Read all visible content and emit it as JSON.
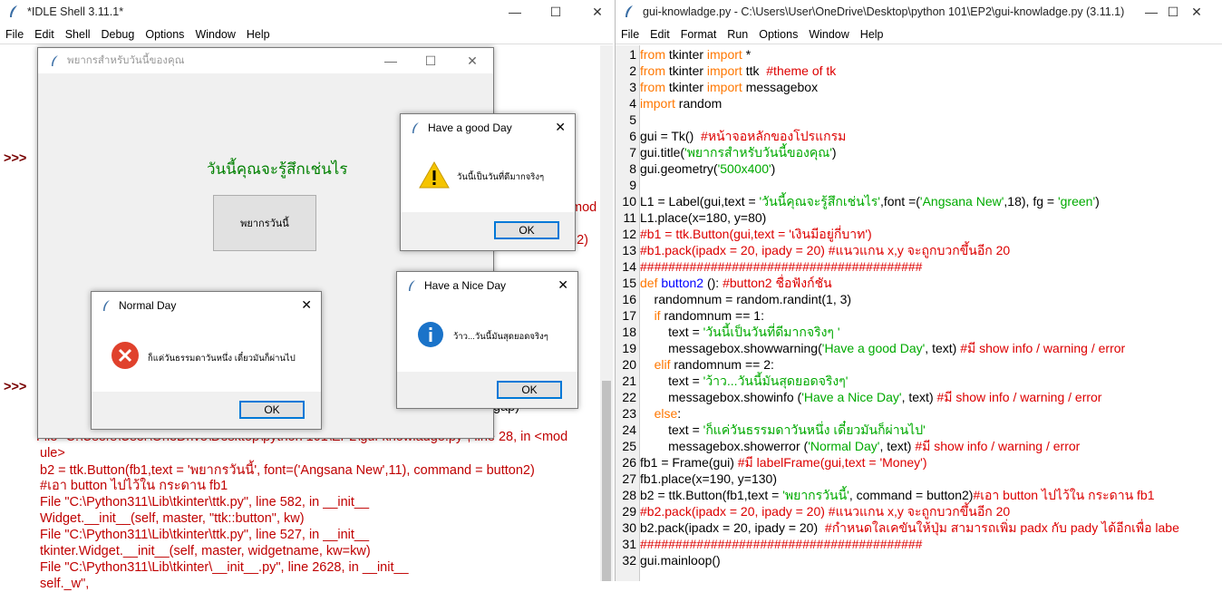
{
  "shell": {
    "title": "*IDLE Shell 3.11.1*",
    "menu": [
      "File",
      "Edit",
      "Shell",
      "Debug",
      "Options",
      "Window",
      "Help"
    ],
    "prompt": ">>>",
    "partial_right_1": "mod",
    "partial_right_2": "n2)",
    "partial_right_3": "gap)",
    "traceback": [
      {
        "text": "  File \"C:\\Users\\User\\OneDrive\\Desktop\\python 101\\EP2\\gui-knowladge.py\", line 28, in <mod"
      },
      {
        "text": "ule>"
      },
      {
        "text": "    b2 = ttk.Button(fb1,text = 'พยากรวันนี้', font=('Angsana New',11), command = button2)"
      },
      {
        "text": "#เอา button ไปไว้ใน กระดาน fb1"
      },
      {
        "text": "  File \"C:\\Python311\\Lib\\tkinter\\ttk.py\", line 582, in __init__"
      },
      {
        "text": "    Widget.__init__(self, master, \"ttk::button\", kw)"
      },
      {
        "text": "  File \"C:\\Python311\\Lib\\tkinter\\ttk.py\", line 527, in __init__"
      },
      {
        "text": "    tkinter.Widget.__init__(self, master, widgetname, kw=kw)"
      },
      {
        "text": "  File \"C:\\Python311\\Lib\\tkinter\\__init__.py\", line 2628, in __init__"
      },
      {
        "text": "    self._w\", "
      }
    ]
  },
  "app": {
    "title": "พยากรสำหรับวันนี้ของคุณ",
    "label": "วันนี้คุณจะรู้สึกเช่นไร",
    "label_color": "#008000",
    "button": "พยากรวันนี้"
  },
  "dialogs": {
    "good": {
      "title": "Have a good Day",
      "message": "วันนี้เป็นวันที่ดีมากจริงๆ",
      "ok": "OK",
      "icon": "warning-icon"
    },
    "nice": {
      "title": "Have a Nice Day",
      "message": "ว้าว...วันนี้มันสุดยอดจริงๆ",
      "ok": "OK",
      "icon": "info-icon"
    },
    "normal": {
      "title": "Normal Day",
      "message": "ก็แค่วันธรรมดาวันหนึ่ง เดี๋ยวมันก็ผ่านไป",
      "ok": "OK",
      "icon": "error-icon"
    }
  },
  "editor": {
    "title": "gui-knowladge.py - C:\\Users\\User\\OneDrive\\Desktop\\python 101\\EP2\\gui-knowladge.py (3.11.1)",
    "menu": [
      "File",
      "Edit",
      "Format",
      "Run",
      "Options",
      "Window",
      "Help"
    ],
    "line_numbers": [
      "1",
      "2",
      "3",
      "4",
      "5",
      "6",
      "7",
      "8",
      "9",
      "10",
      "11",
      "12",
      "13",
      "14",
      "15",
      "16",
      "17",
      "18",
      "19",
      "20",
      "21",
      "22",
      "23",
      "24",
      "25",
      "26",
      "27",
      "28",
      "29",
      "30",
      "31",
      "32"
    ]
  }
}
